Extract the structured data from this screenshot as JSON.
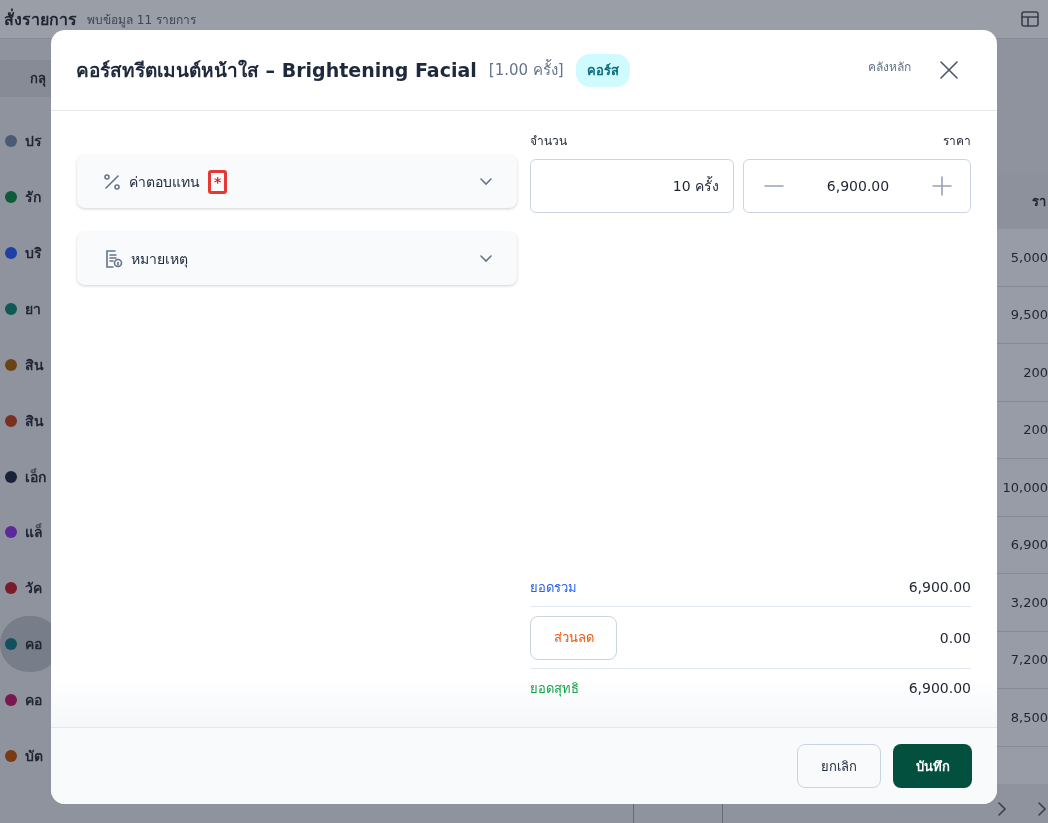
{
  "page": {
    "title": "สั่งรายการ",
    "count": "พบข้อมูล 11 รายการ",
    "group_pill": "กลุ",
    "categories": [
      {
        "label": "ปร",
        "color": "#4b5a73",
        "selected": false
      },
      {
        "label": "รัก",
        "color": "#0f5a3a",
        "selected": false
      },
      {
        "label": "บริ",
        "color": "#1e3fa8",
        "selected": false
      },
      {
        "label": "ยา",
        "color": "#0f5a55",
        "selected": false
      },
      {
        "label": "สิน",
        "color": "#6b4416",
        "selected": false
      },
      {
        "label": "สิน",
        "color": "#7a3020",
        "selected": false
      },
      {
        "label": "เอ็ก",
        "color": "#1a2238",
        "selected": false
      },
      {
        "label": "แล็",
        "color": "#5b2a9a",
        "selected": false
      },
      {
        "label": "วัค",
        "color": "#7a1c28",
        "selected": false
      },
      {
        "label": "คอ",
        "color": "#125060",
        "selected": true
      },
      {
        "label": "คอ",
        "color": "#7a1650",
        "selected": false
      },
      {
        "label": "บัต",
        "color": "#7a3a14",
        "selected": false
      }
    ],
    "price_column": {
      "header": "รา",
      "cells": [
        "5,000",
        "9,500",
        "200",
        "200",
        "10,000",
        "6,900",
        "3,200",
        "7,200",
        "8,500"
      ]
    }
  },
  "dialog": {
    "title": "คอร์สทรีตเมนต์หน้าใส – Brightening Facial",
    "unit_note": "[1.00 ครั้ง]",
    "badge": "คอร์ส",
    "warehouse": "คลังหลัก",
    "sections": [
      {
        "kind": "percent",
        "label": "ค่าตอบแทน",
        "required": true,
        "required_mark": "*",
        "highlighted": true,
        "expanded": false
      },
      {
        "kind": "note",
        "label": "หมายเหตุ",
        "required": false,
        "expanded": false
      }
    ],
    "quantity": {
      "label": "จำนวน",
      "value": "10 ครั้ง"
    },
    "price": {
      "label": "ราคา",
      "value": "6,900.00"
    },
    "summary": {
      "total_label": "ยอดรวม",
      "total": "6,900.00",
      "discount_button": "ส่วนลด",
      "discount": "0.00",
      "net_label": "ยอดสุทธิ",
      "net": "6,900.00"
    },
    "buttons": {
      "cancel": "ยกเลิก",
      "save": "บันทึก"
    }
  }
}
